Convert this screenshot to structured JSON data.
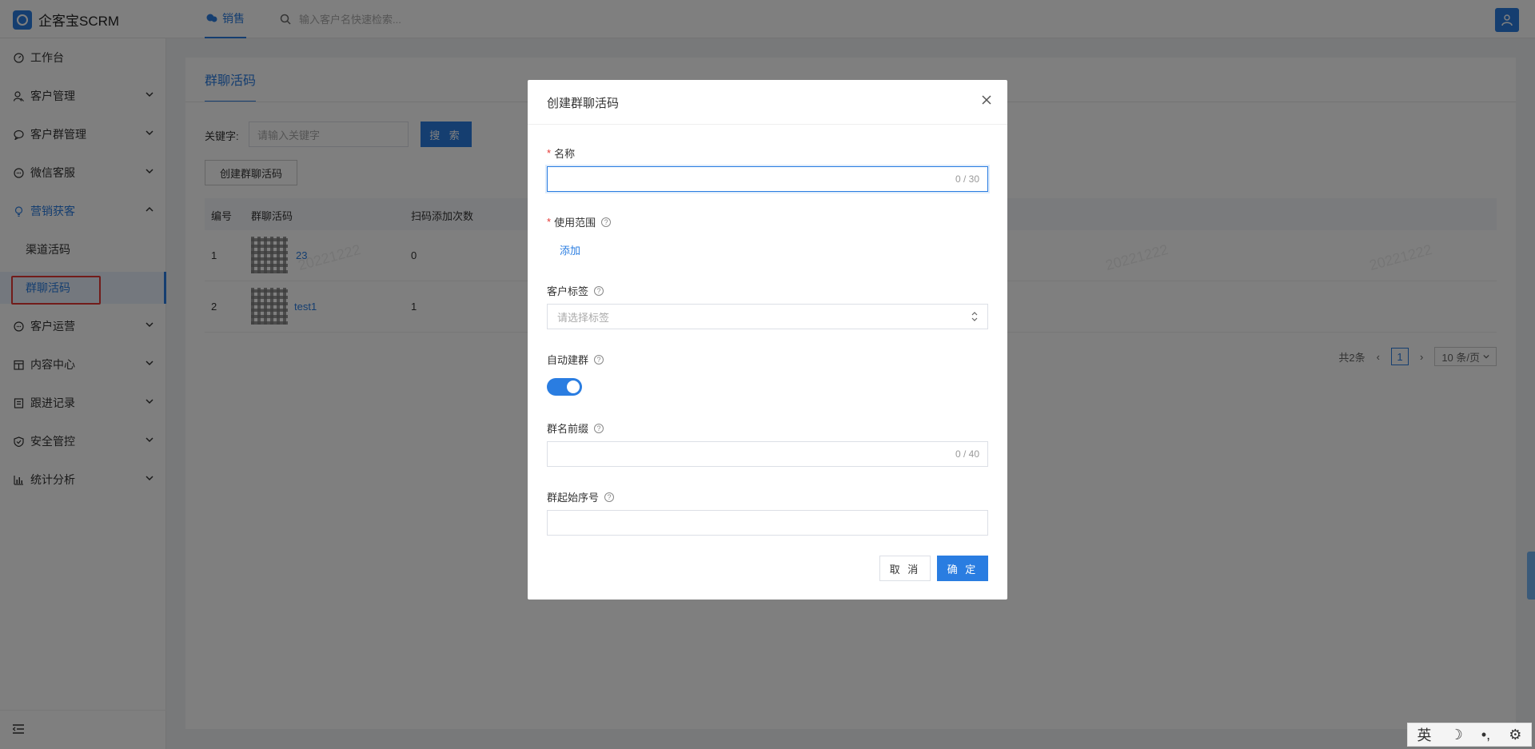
{
  "app": {
    "name": "企客宝SCRM"
  },
  "topbar": {
    "tab_label": "销售",
    "search_placeholder": "输入客户名快速检索..."
  },
  "sidebar": {
    "items": [
      {
        "label": "工作台",
        "icon": "dashboard-icon",
        "has_children": false
      },
      {
        "label": "客户管理",
        "icon": "user-manage-icon",
        "has_children": true
      },
      {
        "label": "客户群管理",
        "icon": "group-chat-icon",
        "has_children": true
      },
      {
        "label": "微信客服",
        "icon": "chat-bubble-icon",
        "has_children": true
      },
      {
        "label": "营销获客",
        "icon": "bulb-icon",
        "has_children": true,
        "open": true
      },
      {
        "label": "客户运营",
        "icon": "chat-bubble-icon",
        "has_children": true
      },
      {
        "label": "内容中心",
        "icon": "store-icon",
        "has_children": true
      },
      {
        "label": "跟进记录",
        "icon": "record-icon",
        "has_children": true
      },
      {
        "label": "安全管控",
        "icon": "shield-icon",
        "has_children": true
      },
      {
        "label": "统计分析",
        "icon": "bar-chart-icon",
        "has_children": true
      }
    ],
    "submenu": [
      {
        "label": "渠道活码"
      },
      {
        "label": "群聊活码",
        "active": true
      }
    ]
  },
  "page": {
    "tab": "群聊活码",
    "keyword_label": "关键字:",
    "keyword_placeholder": "请输入关键字",
    "search_button": "搜 索",
    "create_button": "创建群聊活码",
    "columns": [
      "编号",
      "群聊活码",
      "扫码添加次数"
    ],
    "rows": [
      {
        "no": "1",
        "name": "23",
        "scans": "0"
      },
      {
        "no": "2",
        "name": "test1",
        "scans": "1"
      }
    ],
    "watermark": "20221222",
    "pagination": {
      "total": "共2条",
      "current": "1",
      "page_size": "10 条/页"
    }
  },
  "modal": {
    "title": "创建群聊活码",
    "name_label": "名称",
    "name_counter": "0 / 30",
    "scope_label": "使用范围",
    "scope_add": "添加",
    "tag_label": "客户标签",
    "tag_placeholder": "请选择标签",
    "auto_label": "自动建群",
    "auto_enabled": true,
    "prefix_label": "群名前缀",
    "prefix_counter": "0 / 40",
    "start_label": "群起始序号",
    "cancel": "取 消",
    "ok": "确 定"
  },
  "ime": {
    "lang": "英"
  },
  "colors": {
    "accent": "#2a7de1",
    "required": "#e53935"
  }
}
